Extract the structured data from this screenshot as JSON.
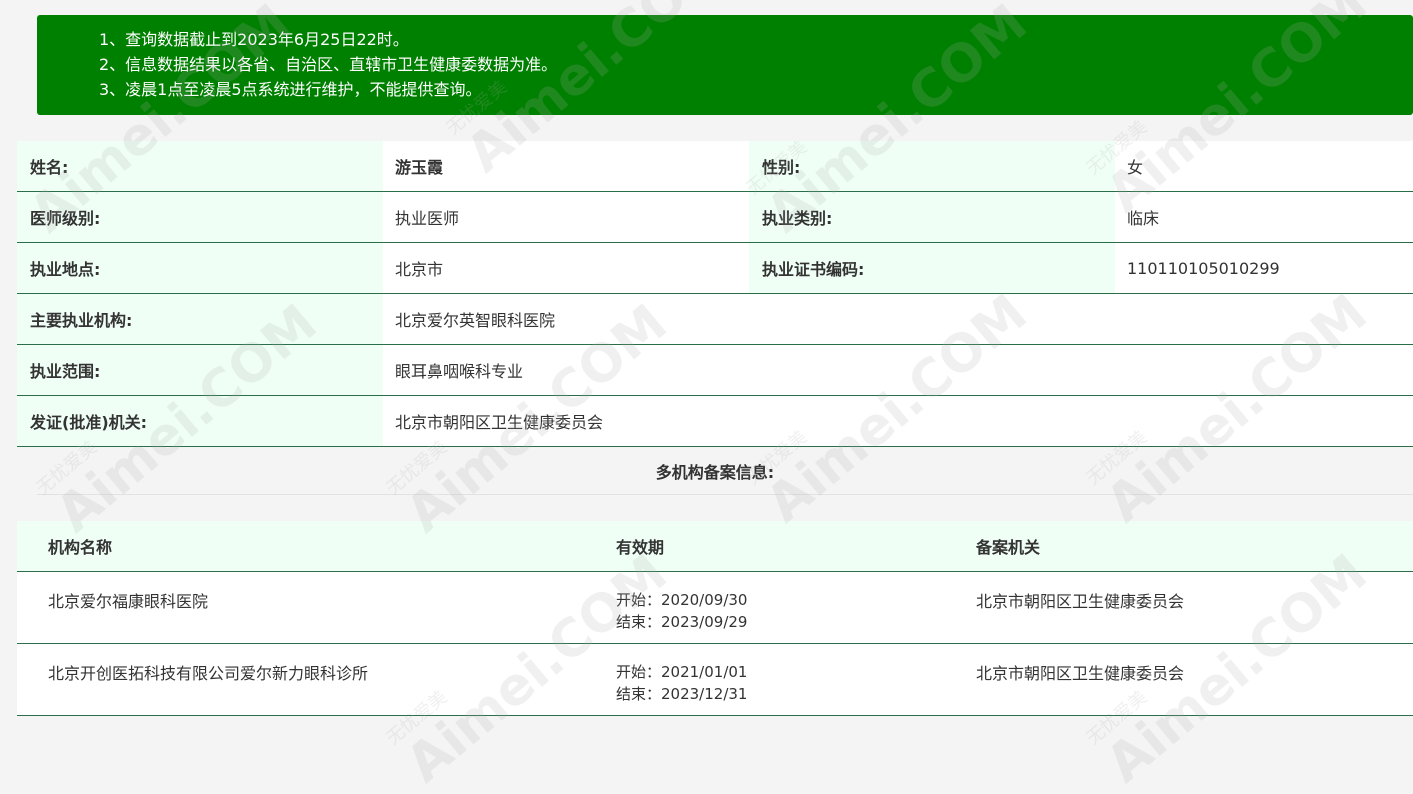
{
  "notice": {
    "lines": [
      "1、查询数据截止到2023年6月25日22时。",
      "2、信息数据结果以各省、自治区、直辖市卫生健康委数据为准。",
      "3、凌晨1点至凌晨5点系统进行维护，不能提供查询。"
    ]
  },
  "info": {
    "name_label": "姓名:",
    "name_value": "游玉霞",
    "gender_label": "性别:",
    "gender_value": "女",
    "level_label": "医师级别:",
    "level_value": "执业医师",
    "category_label": "执业类别:",
    "category_value": "临床",
    "location_label": "执业地点:",
    "location_value": "北京市",
    "cert_label": "执业证书编码:",
    "cert_value": "110110105010299",
    "institution_label": "主要执业机构:",
    "institution_value": "北京爱尔英智眼科医院",
    "scope_label": "执业范围:",
    "scope_value": "眼耳鼻咽喉科专业",
    "authority_label": "发证(批准)机关:",
    "authority_value": "北京市朝阳区卫生健康委员会"
  },
  "multi": {
    "title": "多机构备案信息:",
    "headers": [
      "机构名称",
      "有效期",
      "备案机关"
    ],
    "rows": [
      {
        "name": "北京爱尔福康眼科医院",
        "start": "开始：2020/09/30",
        "end": "结束：2023/09/29",
        "authority": "北京市朝阳区卫生健康委员会"
      },
      {
        "name": "北京开创医拓科技有限公司爱尔新力眼科诊所",
        "start": "开始：2021/01/01",
        "end": "结束：2023/12/31",
        "authority": "北京市朝阳区卫生健康委员会"
      }
    ]
  },
  "watermark": {
    "big": "Aimei.COM",
    "small": "无忧爱美"
  }
}
